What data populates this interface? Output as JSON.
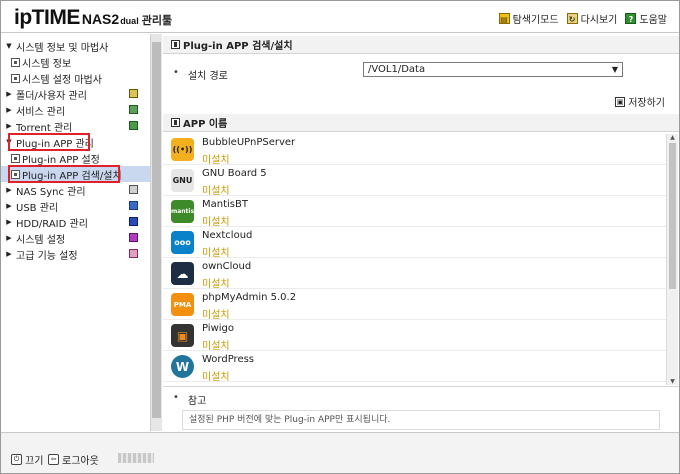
{
  "header": {
    "brand": "ipTIME",
    "model": "NAS2",
    "edition": "dual",
    "tool_name": "관리툴",
    "links": [
      {
        "label": "탐색기모드",
        "icon": "explorer-icon"
      },
      {
        "label": "다시보기",
        "icon": "reload-icon"
      },
      {
        "label": "도움말",
        "icon": "help-icon"
      }
    ]
  },
  "sidebar": {
    "items": [
      {
        "label": "시스템 정보 및 마법사",
        "caret": "▼"
      },
      {
        "label": "시스템 정보"
      },
      {
        "label": "시스템 설정 마법사"
      },
      {
        "label": "폴더/사용자 관리",
        "caret": "▶"
      },
      {
        "label": "서비스 관리",
        "caret": "▶"
      },
      {
        "label": "Torrent 관리",
        "caret": "▶"
      },
      {
        "label": "Plug-in APP 관리",
        "caret": "▼"
      },
      {
        "label": "Plug-in APP 설정"
      },
      {
        "label": "Plug-in APP 검색/설치"
      },
      {
        "label": "NAS Sync 관리",
        "caret": "▶"
      },
      {
        "label": "USB 관리",
        "caret": "▶"
      },
      {
        "label": "HDD/RAID 관리",
        "caret": "▶"
      },
      {
        "label": "시스템 설정",
        "caret": "▶"
      },
      {
        "label": "고급 기능 설정",
        "caret": "▶"
      }
    ]
  },
  "footer": {
    "power_label": "끄기",
    "logout_label": "로그아웃"
  },
  "main": {
    "section_title": "Plug-in APP 검색/설치",
    "install_path_label": "설치 경로",
    "install_path_value": "/VOL1/Data",
    "save_label": "저장하기",
    "app_header": "APP 이름",
    "apps": [
      {
        "name": "BubbleUPnPServer",
        "status": "미설치",
        "icon_color": "#f3b01c",
        "icon_text": "((•))"
      },
      {
        "name": "GNU Board 5",
        "status": "미설치",
        "icon_color": "#e6e6e6",
        "icon_text": "GNU"
      },
      {
        "name": "MantisBT",
        "status": "미설치",
        "icon_color": "#3d8a2a",
        "icon_text": "mantis"
      },
      {
        "name": "Nextcloud",
        "status": "미설치",
        "icon_color": "#0a82c9",
        "icon_text": "ooo"
      },
      {
        "name": "ownCloud",
        "status": "미설치",
        "icon_color": "#1d2d44",
        "icon_text": "☁"
      },
      {
        "name": "phpMyAdmin 5.0.2",
        "status": "미설치",
        "icon_color": "#f29111",
        "icon_text": "PMA"
      },
      {
        "name": "Piwigo",
        "status": "미설치",
        "icon_color": "#333333",
        "icon_text": "▣"
      },
      {
        "name": "WordPress",
        "status": "미설치",
        "icon_color": "#21759b",
        "icon_text": "W"
      }
    ],
    "note_title": "참고",
    "note_text": "설정된 PHP 버전에 맞는 Plug-in APP만 표시됩니다."
  }
}
